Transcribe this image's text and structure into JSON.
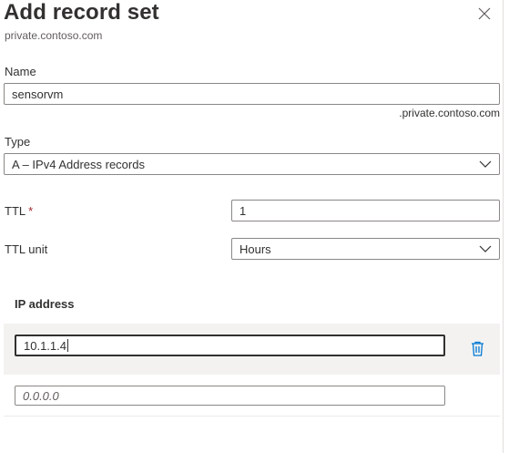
{
  "panel": {
    "title": "Add record set",
    "subtitle": "private.contoso.com"
  },
  "form": {
    "name": {
      "label": "Name",
      "value": "sensorvm",
      "suffix": ".private.contoso.com"
    },
    "type": {
      "label": "Type",
      "value": "A – IPv4 Address records"
    },
    "ttl": {
      "label": "TTL",
      "required_mark": "*",
      "value": "1"
    },
    "ttl_unit": {
      "label": "TTL unit",
      "value": "Hours"
    }
  },
  "ip_section": {
    "title": "IP address",
    "entries": [
      {
        "value": "10.1.1.4"
      }
    ],
    "new_entry_placeholder": "0.0.0.0"
  },
  "icons": {
    "close": "close-icon",
    "chevron": "chevron-down-icon",
    "delete": "trash-icon"
  },
  "colors": {
    "accent": "#0078d4",
    "required": "#a4262c",
    "row_bg": "#f3f2f1"
  }
}
